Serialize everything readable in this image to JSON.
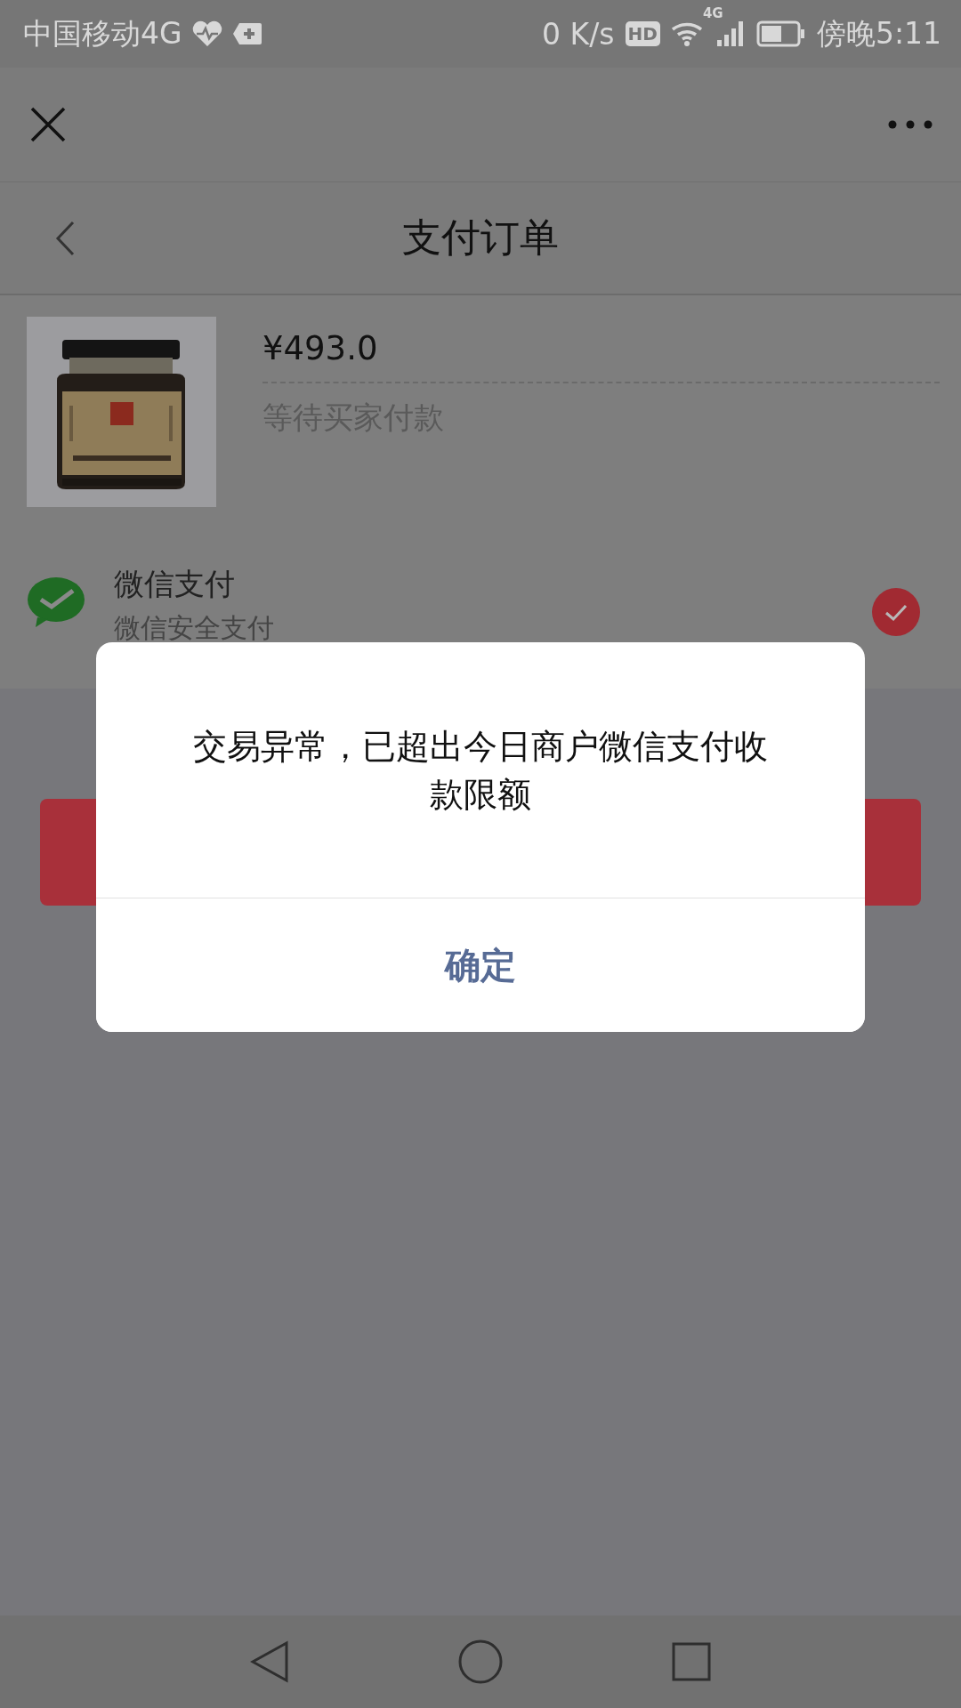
{
  "status_bar": {
    "carrier": "中国移动4G",
    "speed": "0 K/s",
    "hd": "HD",
    "network": "4G",
    "time": "傍晚5:11"
  },
  "header": {
    "title": "支付订单"
  },
  "order": {
    "price": "¥493.0",
    "status": "等待买家付款"
  },
  "payment_methods": [
    {
      "name": "微信支付",
      "subtitle": "微信安全支付",
      "selected": true
    }
  ],
  "dialog": {
    "message": "交易异常，已超出今日商户微信支付收款限额",
    "button": "确定"
  }
}
